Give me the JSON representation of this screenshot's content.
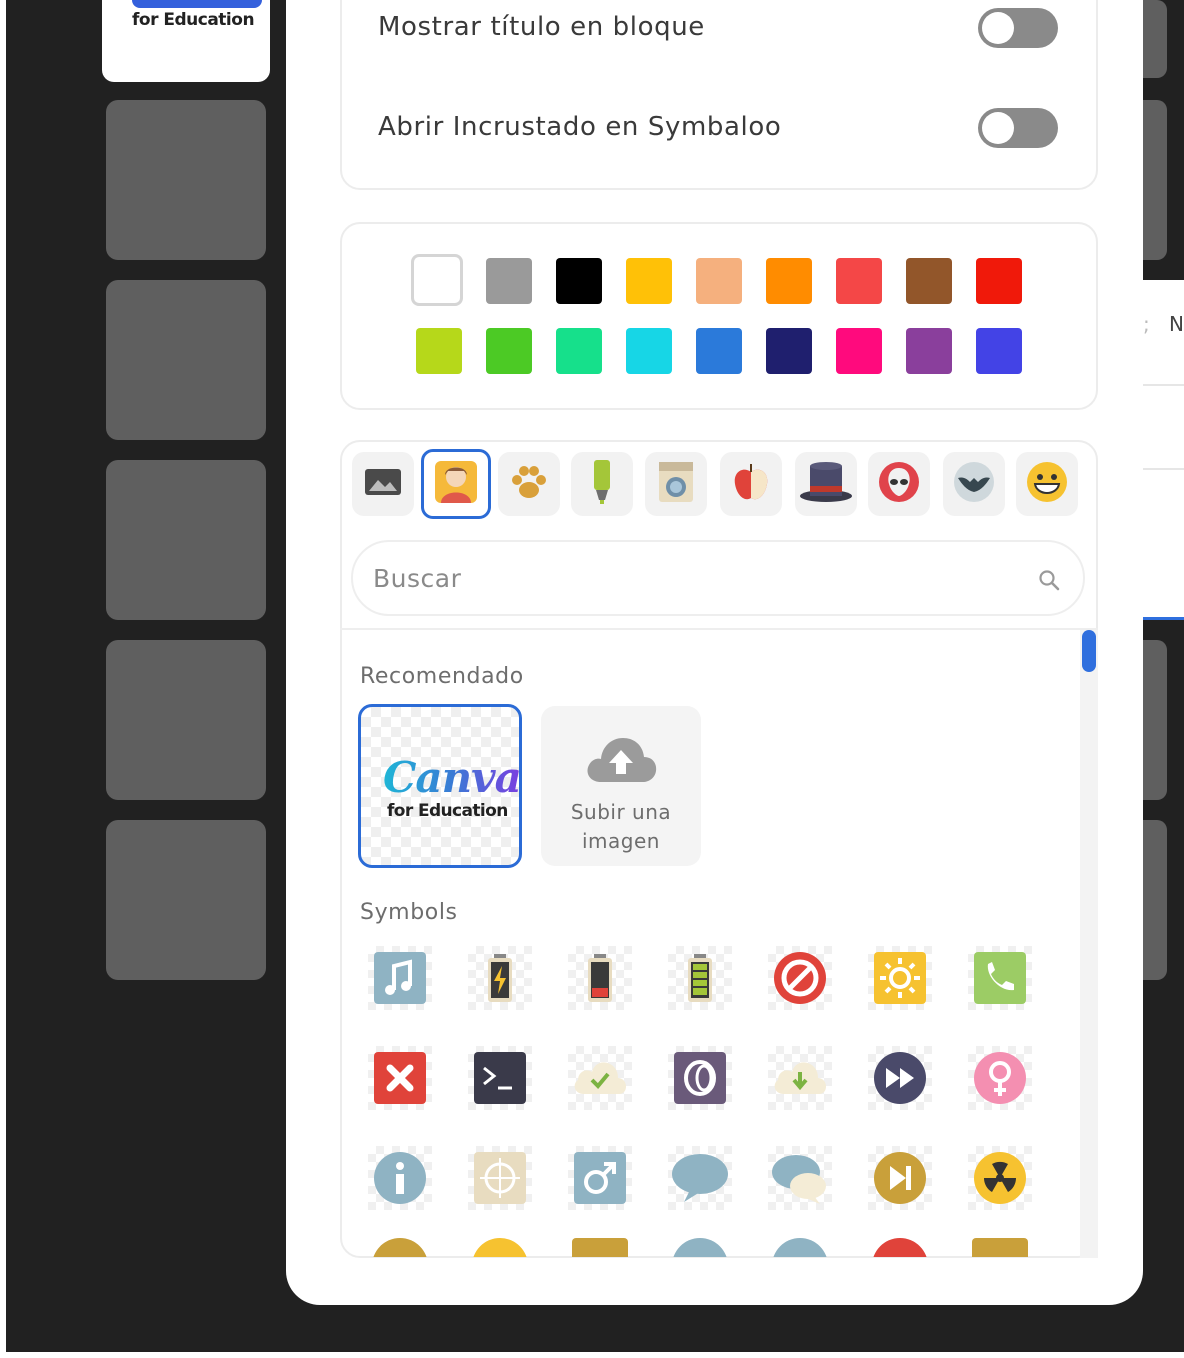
{
  "background": {
    "canva_tile_text": "for Education",
    "right_panel_text": "N"
  },
  "settings": {
    "show_title_label": "Mostrar título en bloque",
    "show_title_on": false,
    "open_embedded_label": "Abrir Incrustado en Symbaloo",
    "open_embedded_on": false
  },
  "colors": {
    "row1": [
      "#ffffff",
      "#9a9a9a",
      "#000000",
      "#ffc107",
      "#f5b07e",
      "#ff8c00",
      "#f44747",
      "#92562a",
      "#f0190a"
    ],
    "row2": [
      "#b6d81a",
      "#4cca25",
      "#16e08b",
      "#17d6e6",
      "#2b7ada",
      "#1f1f6e",
      "#ff0a7d",
      "#8a3f9c",
      "#4343e6"
    ],
    "selected": "#ffffff"
  },
  "icon_tabs": [
    "image-icon",
    "person-icon",
    "paw-icon",
    "highlighter-icon",
    "washing-machine-icon",
    "apple-icon",
    "top-hat-icon",
    "alien-icon",
    "bat-icon",
    "smiley-icon"
  ],
  "active_tab": "person-icon",
  "search": {
    "placeholder": "Buscar"
  },
  "recommended": {
    "heading": "Recomendado",
    "canva_logo": "Canva",
    "canva_sub": "for Education",
    "upload_label_1": "Subir una",
    "upload_label_2": "imagen"
  },
  "symbols": {
    "heading": "Symbols",
    "icons": [
      "music-note-icon",
      "battery-charging-icon",
      "battery-low-icon",
      "battery-full-icon",
      "no-entry-icon",
      "sun-brightness-icon",
      "phone-icon",
      "close-x-icon",
      "terminal-icon",
      "cloud-check-icon",
      "opera-icon",
      "cloud-download-icon",
      "fast-forward-icon",
      "female-symbol-icon",
      "info-icon",
      "target-icon",
      "male-symbol-icon",
      "speech-bubble-icon",
      "chat-bubbles-icon",
      "skip-next-icon",
      "radiation-icon"
    ]
  }
}
